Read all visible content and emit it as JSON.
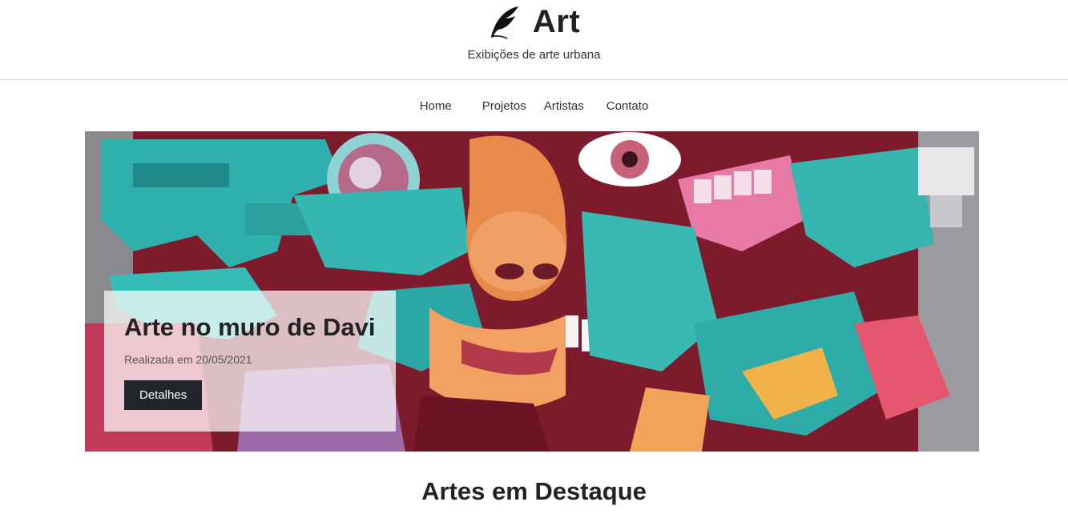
{
  "header": {
    "title": "Art",
    "tagline": "Exibições de arte urbana",
    "logo_icon": "feather-icon"
  },
  "nav": {
    "items": [
      {
        "label": "Home"
      },
      {
        "label": "Projetos"
      },
      {
        "label": "Artistas"
      },
      {
        "label": "Contato"
      }
    ]
  },
  "hero": {
    "heading": "Arte no muro de Davi",
    "subtitle": "Realizada em 20/05/2021",
    "button_label": "Detalhes"
  },
  "featured": {
    "title": "Artes em Destaque"
  },
  "colors": {
    "button_bg": "#212529",
    "graffiti_teal": "#2fb0ae",
    "graffiti_red": "#8c1b2e",
    "graffiti_orange": "#e88a4a"
  }
}
